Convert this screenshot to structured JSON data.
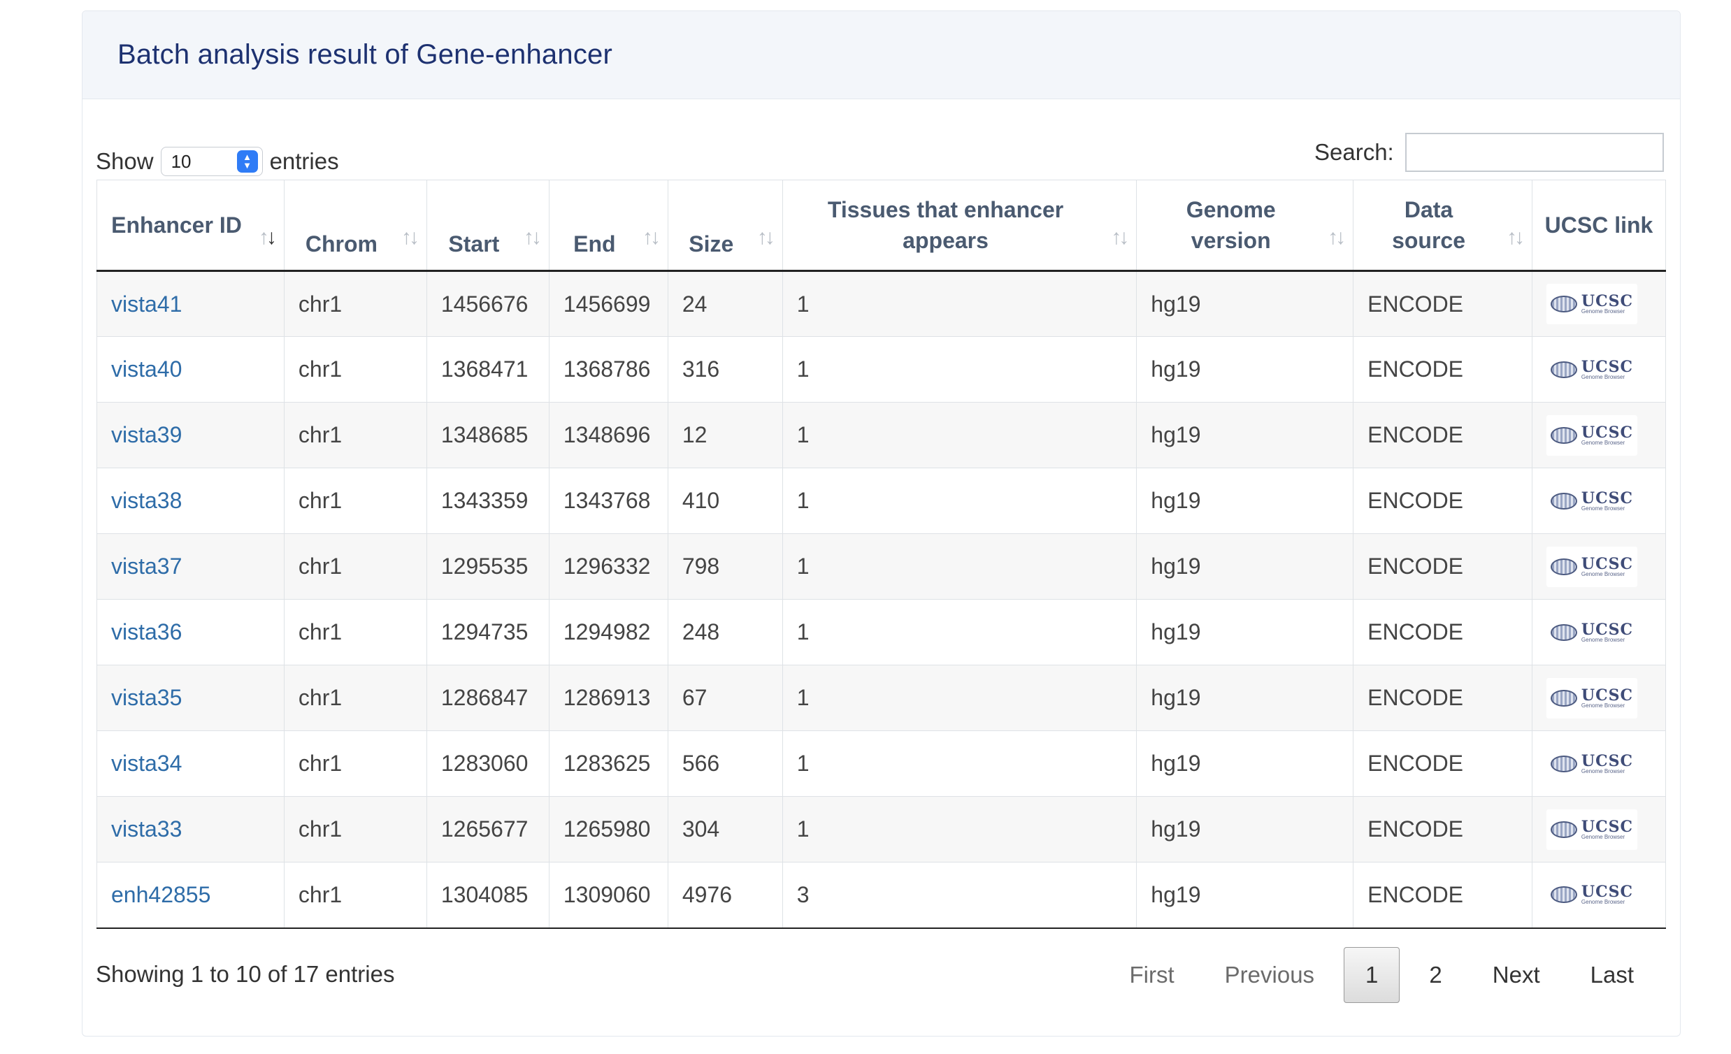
{
  "panel": {
    "title": "Batch analysis result of Gene-enhancer"
  },
  "length": {
    "show_label": "Show",
    "value": "10",
    "entries_label": "entries"
  },
  "search": {
    "label": "Search:",
    "value": ""
  },
  "table": {
    "columns": [
      {
        "label": "Enhancer ID",
        "sort": "desc-active"
      },
      {
        "label": "Chrom"
      },
      {
        "label": "Start"
      },
      {
        "label": "End"
      },
      {
        "label": "Size"
      },
      {
        "label": "Tissues that enhancer appears"
      },
      {
        "label": "Genome version"
      },
      {
        "label": "Data source"
      },
      {
        "label": "UCSC link"
      }
    ],
    "rows": [
      {
        "id": "vista41",
        "chrom": "chr1",
        "start": "1456676",
        "end": "1456699",
        "size": "24",
        "tissues": "1",
        "genome": "hg19",
        "source": "ENCODE"
      },
      {
        "id": "vista40",
        "chrom": "chr1",
        "start": "1368471",
        "end": "1368786",
        "size": "316",
        "tissues": "1",
        "genome": "hg19",
        "source": "ENCODE"
      },
      {
        "id": "vista39",
        "chrom": "chr1",
        "start": "1348685",
        "end": "1348696",
        "size": "12",
        "tissues": "1",
        "genome": "hg19",
        "source": "ENCODE"
      },
      {
        "id": "vista38",
        "chrom": "chr1",
        "start": "1343359",
        "end": "1343768",
        "size": "410",
        "tissues": "1",
        "genome": "hg19",
        "source": "ENCODE"
      },
      {
        "id": "vista37",
        "chrom": "chr1",
        "start": "1295535",
        "end": "1296332",
        "size": "798",
        "tissues": "1",
        "genome": "hg19",
        "source": "ENCODE"
      },
      {
        "id": "vista36",
        "chrom": "chr1",
        "start": "1294735",
        "end": "1294982",
        "size": "248",
        "tissues": "1",
        "genome": "hg19",
        "source": "ENCODE"
      },
      {
        "id": "vista35",
        "chrom": "chr1",
        "start": "1286847",
        "end": "1286913",
        "size": "67",
        "tissues": "1",
        "genome": "hg19",
        "source": "ENCODE"
      },
      {
        "id": "vista34",
        "chrom": "chr1",
        "start": "1283060",
        "end": "1283625",
        "size": "566",
        "tissues": "1",
        "genome": "hg19",
        "source": "ENCODE"
      },
      {
        "id": "vista33",
        "chrom": "chr1",
        "start": "1265677",
        "end": "1265980",
        "size": "304",
        "tissues": "1",
        "genome": "hg19",
        "source": "ENCODE"
      },
      {
        "id": "enh42855",
        "chrom": "chr1",
        "start": "1304085",
        "end": "1309060",
        "size": "4976",
        "tissues": "3",
        "genome": "hg19",
        "source": "ENCODE"
      }
    ],
    "ucsc_logo": {
      "title": "UCSC",
      "subtitle": "Genome Browser",
      "icon": "ucsc-genome-browser-logo"
    }
  },
  "info": "Showing 1 to 10 of 17 entries",
  "pagination": {
    "first": "First",
    "previous": "Previous",
    "pages": [
      "1",
      "2"
    ],
    "current": "1",
    "next": "Next",
    "last": "Last"
  },
  "colors": {
    "title": "#1d3170",
    "link": "#2e6ca8",
    "header_bg": "#f3f6fa",
    "select_accent": "#2f7cf6"
  }
}
